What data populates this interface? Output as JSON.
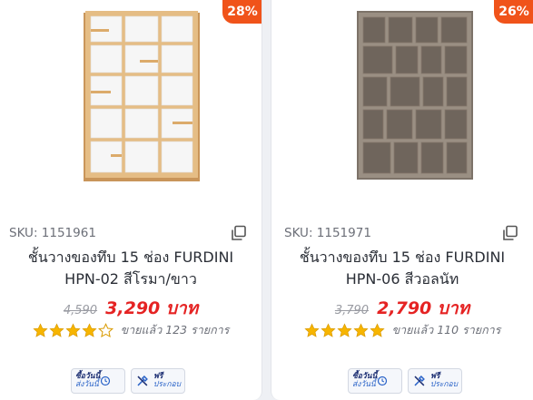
{
  "products": [
    {
      "discount_badge": "28%",
      "badge_color": "#f0531a",
      "sku": "SKU: 1151961",
      "title_line1": "ชั้นวางของทึบ 15 ช่อง FURDINI",
      "title_line2": "HPN-02 สีโรมา/ขาว",
      "old_price": "4,590",
      "new_price": "3,290 บาท",
      "rating": 4,
      "sold_text": "ขายแล้ว 123 รายการ",
      "service_delivery_line1": "ซื้อวันนี้",
      "service_delivery_line2": "ส่งวันนี้",
      "service_assembly_line1": "ฟรี",
      "service_assembly_line2": "ประกอบ"
    },
    {
      "discount_badge": "26%",
      "badge_color": "#f0531a",
      "sku": "SKU: 1151971",
      "title_line1": "ชั้นวางของทึบ 15 ช่อง FURDINI",
      "title_line2": "HPN-06 สีวอลนัท",
      "old_price": "3,790",
      "new_price": "2,790 บาท",
      "rating": 5,
      "sold_text": "ขายแล้ว 110 รายการ",
      "service_delivery_line1": "ซื้อวันนี้",
      "service_delivery_line2": "ส่งวันนี้",
      "service_assembly_line1": "ฟรี",
      "service_assembly_line2": "ประกอบ"
    }
  ],
  "colors": {
    "price_red": "#e52323",
    "star_gold": "#f7b500",
    "shelf_oak": "#d9ae73",
    "shelf_white": "#f4f4f4",
    "shelf_walnut": "#8f8478"
  }
}
